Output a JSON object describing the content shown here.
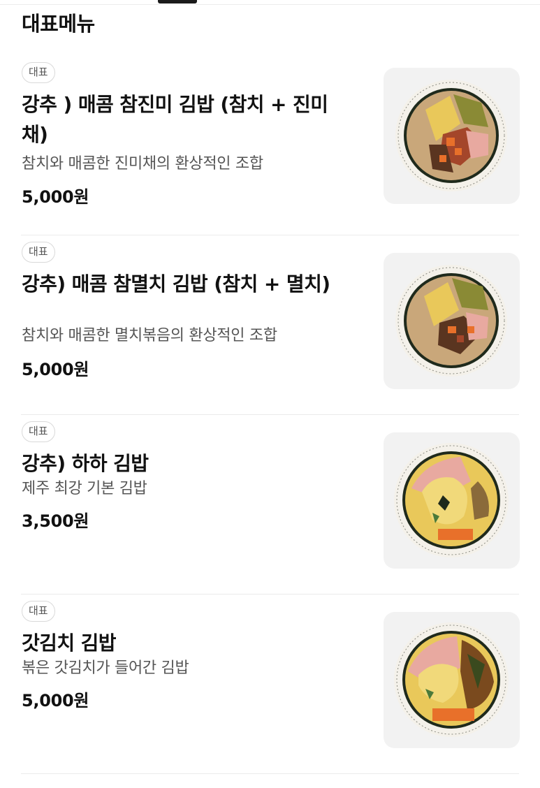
{
  "section": {
    "title": "대표메뉴"
  },
  "items": [
    {
      "badge": "대표",
      "name": "강추 ) 매콤 참진미 김밥 (참치 + 진미채)",
      "description": "참치와 매콤한 진미채의 환상적인 조합",
      "price": "5,000원",
      "image_icon": "spicy-tuna-squid-kimbap-photo"
    },
    {
      "badge": "대표",
      "name": "강추) 매콤 참멸치 김밥 (참치 + 멸치)",
      "description": "참치와 매콤한 멸치볶음의 환상적인 조합",
      "price": "5,000원",
      "image_icon": "spicy-tuna-anchovy-kimbap-photo"
    },
    {
      "badge": "대표",
      "name": "강추) 하하 김밥",
      "description": "제주 최강 기본 김밥",
      "price": "3,500원",
      "image_icon": "basic-kimbap-photo"
    },
    {
      "badge": "대표",
      "name": "갓김치 김밥",
      "description": "볶은 갓김치가 들어간 김밥",
      "price": "5,000원",
      "image_icon": "mustard-kimchi-kimbap-photo"
    }
  ],
  "colors": {
    "seaweed": "#1f2a1c",
    "rice": "#f4f1ea",
    "egg": "#e9c85a",
    "carrot": "#e8702a",
    "spicy": "#a4462a",
    "kimchi": "#7a4a1e",
    "ham": "#e8a9a0"
  }
}
